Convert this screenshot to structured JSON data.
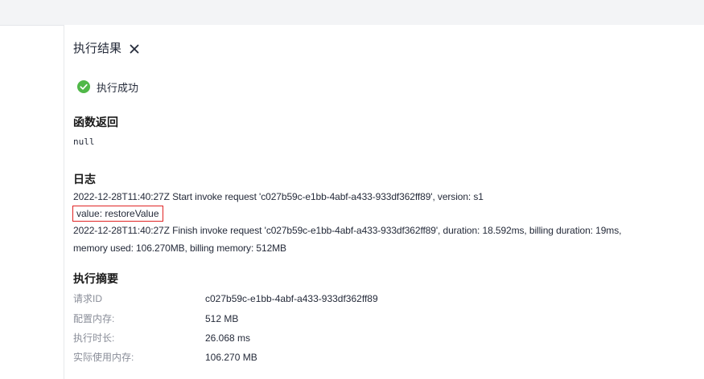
{
  "panel": {
    "title": "执行结果",
    "close_symbol": "✕"
  },
  "status": {
    "text": "执行成功",
    "icon": "check-circle-icon",
    "color": "#50b848"
  },
  "return_section": {
    "title": "函数返回",
    "value": "null"
  },
  "log_section": {
    "title": "日志",
    "lines": [
      "2022-12-28T11:40:27Z Start invoke request 'c027b59c-e1bb-4abf-a433-933df362ff89', version: s1",
      "value: restoreValue",
      "2022-12-28T11:40:27Z Finish invoke request 'c027b59c-e1bb-4abf-a433-933df362ff89', duration: 18.592ms, billing duration: 19ms,",
      "memory used: 106.270MB, billing memory: 512MB"
    ],
    "highlight_color": "#e02424"
  },
  "summary_section": {
    "title": "执行摘要",
    "rows": [
      {
        "label": "请求ID",
        "value": "c027b59c-e1bb-4abf-a433-933df362ff89"
      },
      {
        "label": "配置内存:",
        "value": "512 MB"
      },
      {
        "label": "执行时长:",
        "value": "26.068 ms"
      },
      {
        "label": "实际使用内存:",
        "value": "106.270 MB"
      }
    ]
  }
}
